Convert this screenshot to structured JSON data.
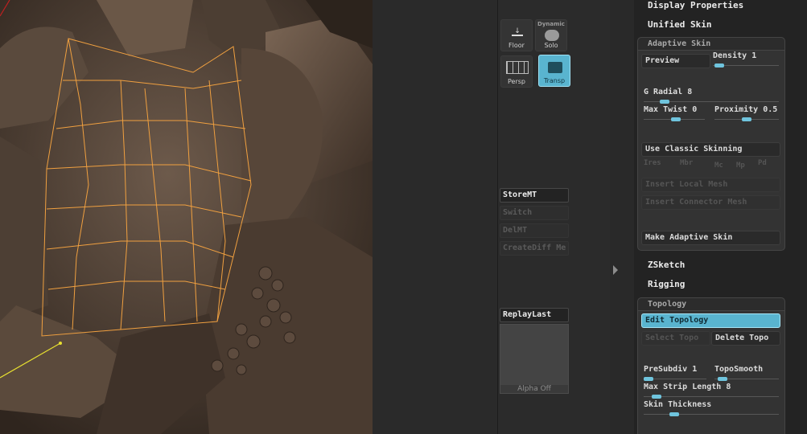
{
  "shelf": {
    "floor": {
      "label": "Floor"
    },
    "solo": {
      "top": "Dynamic",
      "label": "Solo"
    },
    "persp": {
      "label": "Persp"
    },
    "transp": {
      "label": "Transp"
    },
    "storemt": "StoreMT",
    "switch": "Switch",
    "delmt": "DelMT",
    "creatediff": "CreateDiff Me",
    "replaylast": "ReplayLast",
    "alpha": "Alpha  Off"
  },
  "palette": {
    "display_properties": "Display Properties",
    "unified_skin": "Unified Skin",
    "adaptive_skin": {
      "title": "Adaptive Skin",
      "preview": "Preview",
      "density": {
        "label": "Density",
        "value": "1",
        "fraction": 0.05
      },
      "g_radial": {
        "label": "G Radial",
        "value": "8",
        "fraction": 0.12
      },
      "max_twist": {
        "label": "Max Twist",
        "value": "0",
        "fraction": 0.45
      },
      "proximity": {
        "label": "Proximity",
        "value": "0.5",
        "fraction": 0.5
      },
      "use_classic": "Use Classic Skinning",
      "ires": "Ires",
      "mbr": "Mbr",
      "mc": "Mc",
      "mp": "Mp",
      "pd": "Pd",
      "insert_local": "Insert Local Mesh",
      "insert_connector": "Insert Connector Mesh",
      "make_adaptive": "Make Adaptive Skin"
    },
    "zsketch": "ZSketch",
    "rigging": "Rigging",
    "topology": {
      "title": "Topology",
      "edit_topology": "Edit Topology",
      "select_topo": "Select Topo",
      "delete_topo": "Delete Topo",
      "presubdiv": {
        "label": "PreSubdiv",
        "value": "1",
        "fraction": 0.1
      },
      "toposmooth": {
        "label": "TopoSmooth",
        "value": "",
        "fraction": 0.1
      },
      "max_strip": {
        "label": "Max Strip Length",
        "value": "8",
        "fraction": 0.1
      },
      "skin_thickness": {
        "label": "Skin Thickness",
        "value": "",
        "fraction": 0.25
      }
    }
  }
}
